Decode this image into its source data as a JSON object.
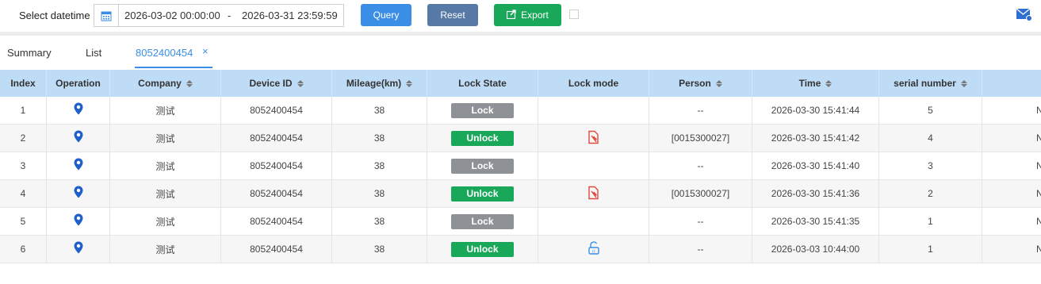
{
  "toolbar": {
    "datetime_label": "Select datetime",
    "start": "2026-03-02 00:00:00",
    "separator": "-",
    "end": "2026-03-31 23:59:59",
    "query_label": "Query",
    "reset_label": "Reset",
    "export_label": "Export",
    "calendar_icon": "calendar-icon",
    "mail_icon": "mail-icon"
  },
  "tabs": {
    "summary": "Summary",
    "list": "List",
    "active": "8052400454",
    "close": "×"
  },
  "table": {
    "headers": [
      "Index",
      "Operation",
      "Company",
      "Device ID",
      "Mileage(km)",
      "Lock State",
      "Lock mode",
      "Person",
      "Time",
      "serial number",
      ""
    ],
    "rows": [
      {
        "index": "1",
        "company": "测试",
        "device_id": "8052400454",
        "mileage": "38",
        "lock_state": "Lock",
        "lock_mode": "",
        "person": "--",
        "time": "2026-03-30 15:41:44",
        "serial": "5",
        "extra": "N"
      },
      {
        "index": "2",
        "company": "测试",
        "device_id": "8052400454",
        "mileage": "38",
        "lock_state": "Unlock",
        "lock_mode": "card",
        "person": "[0015300027]",
        "time": "2026-03-30 15:41:42",
        "serial": "4",
        "extra": "N"
      },
      {
        "index": "3",
        "company": "测试",
        "device_id": "8052400454",
        "mileage": "38",
        "lock_state": "Lock",
        "lock_mode": "",
        "person": "--",
        "time": "2026-03-30 15:41:40",
        "serial": "3",
        "extra": "N"
      },
      {
        "index": "4",
        "company": "测试",
        "device_id": "8052400454",
        "mileage": "38",
        "lock_state": "Unlock",
        "lock_mode": "card",
        "person": "[0015300027]",
        "time": "2026-03-30 15:41:36",
        "serial": "2",
        "extra": "N"
      },
      {
        "index": "5",
        "company": "测试",
        "device_id": "8052400454",
        "mileage": "38",
        "lock_state": "Lock",
        "lock_mode": "",
        "person": "--",
        "time": "2026-03-30 15:41:35",
        "serial": "1",
        "extra": "N"
      },
      {
        "index": "6",
        "company": "测试",
        "device_id": "8052400454",
        "mileage": "38",
        "lock_state": "Unlock",
        "lock_mode": "remote",
        "person": "--",
        "time": "2026-03-03 10:44:00",
        "serial": "1",
        "extra": "N"
      }
    ]
  },
  "colors": {
    "primary": "#3a8ee6",
    "reset": "#5679a6",
    "export": "#19a75a",
    "lock_badge": "#8e9196",
    "unlock_badge": "#19a75a",
    "header_bg": "#bfdcf7",
    "card_icon": "#e04a3f"
  }
}
